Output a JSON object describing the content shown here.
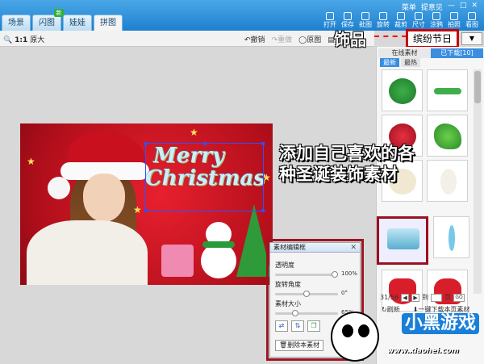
{
  "tabs": [
    {
      "label": "场景"
    },
    {
      "label": "闪图",
      "badge": "新"
    },
    {
      "label": "娃娃"
    },
    {
      "label": "拼图"
    }
  ],
  "menu": [
    "菜单",
    "提意见"
  ],
  "tools": [
    "打开",
    "保存",
    "批图",
    "旋转",
    "裁剪",
    "尺寸",
    "涂鸦",
    "拍照",
    "看图"
  ],
  "zoom": {
    "ratio": "1:1",
    "label": "原大"
  },
  "actions": {
    "undo": "撤销",
    "redo": "重做",
    "original": "原图",
    "compare": "对"
  },
  "callout1": "饰品",
  "category": "缤纷节日",
  "callout2_line1": "添加自己喜欢的各",
  "callout2_line2": "种圣诞装饰素材",
  "canvas_text": {
    "line1": "Merry",
    "line2": "Christmas"
  },
  "right_panel": {
    "tabs": [
      "在线素材",
      "已下载[10]"
    ],
    "subtabs": [
      "最新",
      "最热"
    ],
    "page_info": "31/56",
    "page_to": "到",
    "page_unit": "页",
    "go": "GO",
    "refresh": "刷新",
    "download_all": "一键下载本页素材"
  },
  "dialog": {
    "title": "素材编辑框",
    "opacity_label": "透明度",
    "opacity_value": "100%",
    "opacity_level": 1.0,
    "rotate_label": "旋转角度",
    "rotate_value": "0°",
    "rotate_level": 0.5,
    "size_label": "素材大小",
    "size_value": "65%",
    "size_level": 0.3,
    "delete": "删除本素材"
  },
  "logo": {
    "text": "小黑游戏",
    "url": "www.xiaohei.com"
  },
  "colors": {
    "accent": "#1e7fcf",
    "highlight": "#c80000",
    "selection": "#3050ff"
  }
}
